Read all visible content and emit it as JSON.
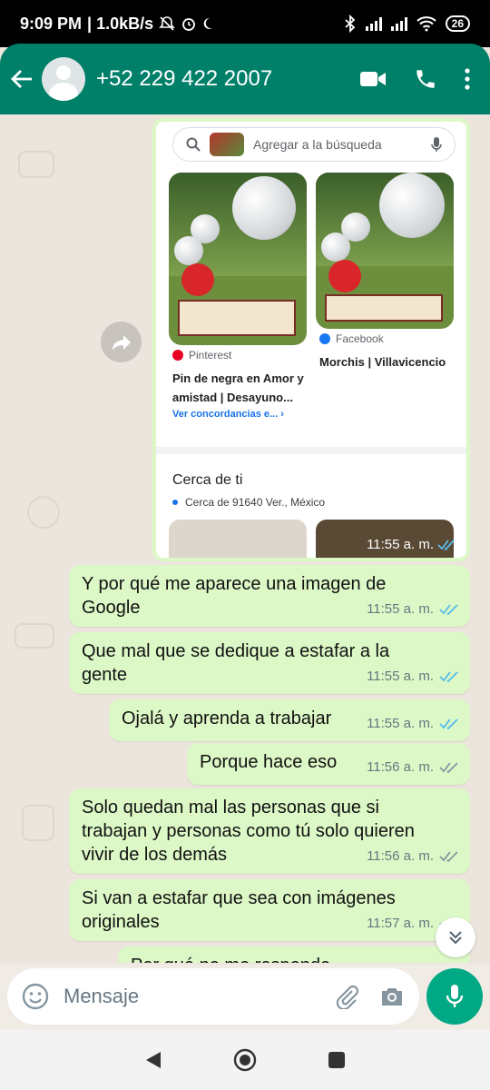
{
  "status_bar": {
    "time": "9:09 PM",
    "network_speed": "| 1.0kB/s",
    "battery": "26"
  },
  "header": {
    "contact": "+52 229 422 2007"
  },
  "image_message": {
    "search_placeholder": "Agregar a la búsqueda",
    "results": [
      {
        "source": "Pinterest",
        "title_line1": "Pin de negra en Amor y",
        "title_line2": "amistad | Desayuno...",
        "match_link": "Ver concordancias e..."
      },
      {
        "source": "Facebook",
        "title_line1": "Morchis | Villavicencio"
      }
    ],
    "nearby_title": "Cerca de ti",
    "nearby_location": "Cerca de 91640 Ver., México",
    "time": "11:55 a. m."
  },
  "messages": [
    {
      "line1": "Y por qué me aparece una imagen de",
      "line2": "Google",
      "time": "11:55 a. m.",
      "status": "read"
    },
    {
      "line1": "Que mal que se dedique a estafar a la",
      "line2": "gente",
      "time": "11:55 a. m.",
      "status": "read"
    },
    {
      "line1": "Ojalá y aprenda a trabajar",
      "time": "11:55 a. m.",
      "status": "read"
    },
    {
      "line1": "Porque hace eso",
      "time": "11:56 a. m.",
      "status": "delivered"
    },
    {
      "line1": "Solo quedan mal las personas que si",
      "line2": "trabajan y personas como tú solo quieren",
      "line3": "vivir de los demás",
      "time": "11:56 a. m.",
      "status": "delivered"
    },
    {
      "line1": "Si van a estafar que sea con imágenes",
      "line2": "originales",
      "time": "11:57 a. m.",
      "status": "delivered"
    },
    {
      "line1": "Por qué no me responde"
    }
  ],
  "composer": {
    "placeholder": "Mensaje"
  },
  "colors": {
    "header": "#008069",
    "bubble": "#dcf8c6",
    "read_tick": "#53bdeb",
    "mic_button": "#00a884"
  }
}
